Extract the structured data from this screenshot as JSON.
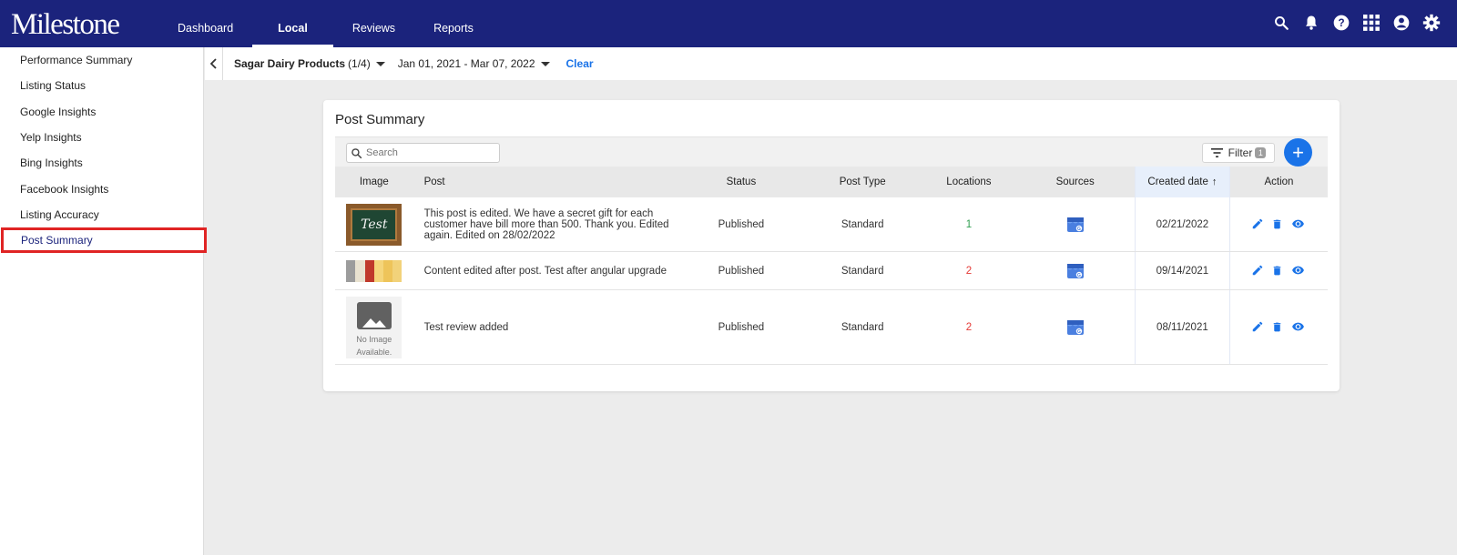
{
  "header": {
    "logo": "Milestone",
    "nav": [
      {
        "label": "Dashboard",
        "active": false
      },
      {
        "label": "Local",
        "active": true
      },
      {
        "label": "Reviews",
        "active": false
      },
      {
        "label": "Reports",
        "active": false
      }
    ],
    "icons": [
      "search-icon",
      "bell-icon",
      "help-icon",
      "apps-icon",
      "account-icon",
      "settings-icon"
    ]
  },
  "sidebar": {
    "items": [
      {
        "label": "Performance Summary"
      },
      {
        "label": "Listing Status"
      },
      {
        "label": "Google Insights"
      },
      {
        "label": "Yelp Insights"
      },
      {
        "label": "Bing Insights"
      },
      {
        "label": "Facebook Insights"
      },
      {
        "label": "Listing Accuracy"
      },
      {
        "label": "Post Summary",
        "active": true
      }
    ]
  },
  "filterbar": {
    "business_name": "Sagar Dairy Products",
    "business_count": "(1/4)",
    "date_range": "Jan 01, 2021 - Mar 07, 2022",
    "clear_label": "Clear"
  },
  "card": {
    "title": "Post Summary",
    "search_placeholder": "Search",
    "filter_label": "Filter",
    "filter_count": "1",
    "add_label": "+"
  },
  "table": {
    "columns": {
      "image": "Image",
      "post": "Post",
      "status": "Status",
      "post_type": "Post Type",
      "locations": "Locations",
      "sources": "Sources",
      "created_date": "Created date",
      "action": "Action"
    },
    "sort_arrow": "↑",
    "rows": [
      {
        "thumb_text": "Test",
        "post": "This post is edited. We have a secret gift for each customer have bill more than 500. Thank you. Edited again. Edited on 28/02/2022",
        "status": "Published",
        "post_type": "Standard",
        "locations": "1",
        "created_date": "02/21/2022"
      },
      {
        "post": "Content edited after post. Test after angular upgrade",
        "status": "Published",
        "post_type": "Standard",
        "locations": "2",
        "created_date": "09/14/2021"
      },
      {
        "no_image_line1": "No Image",
        "no_image_line2": "Available.",
        "post": "Test review added",
        "status": "Published",
        "post_type": "Standard",
        "locations": "2",
        "created_date": "08/11/2021"
      }
    ]
  },
  "colors": {
    "header_bg": "#1b237c",
    "accent": "#1a73e8",
    "highlight_border": "#e02424",
    "location_one": "#2e9e4f",
    "location_many": "#e53935"
  }
}
